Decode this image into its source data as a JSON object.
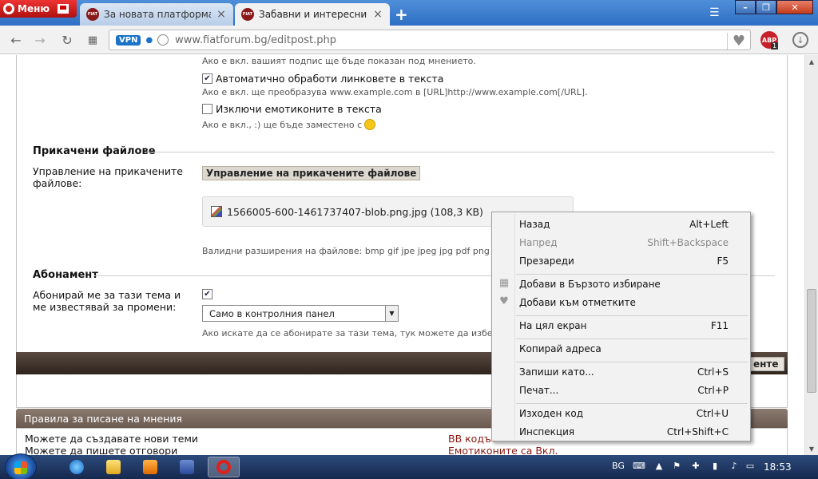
{
  "browser": {
    "menu_label": "Меню",
    "tabs": [
      {
        "title": "За новата платформа на",
        "active": false,
        "favicon": "FIAT"
      },
      {
        "title": "Забавни и интересни сни",
        "active": true,
        "favicon": "FIAT"
      }
    ],
    "address": {
      "vpn_label": "VPN",
      "url": "www.fiatforum.bg/editpost.php"
    },
    "abp_label": "ABP",
    "abp_count": "1"
  },
  "form": {
    "signature_hint": "Ако е вкл. вашият подпис ще бъде показан под мнението.",
    "auto_links_label": "Автоматично обработи линковете в текста",
    "auto_links_hint": "Ако е вкл. ще преобразува www.example.com в [URL]http://www.example.com[/URL].",
    "disable_smilies_label": "Изключи емотиконите в текста",
    "disable_smilies_hint": "Ако е вкл., :) ще бъде заместено с",
    "attachments_title": "Прикачени файлове",
    "manage_label": "Управление на прикачените файлове:",
    "manage_button": "Управление на прикачените файлове",
    "file_name": "1566005-600-1461737407-blob.png.jpg (108,3 KB)",
    "valid_ext": "Валидни разширения на файлове: bmp gif jpe jpeg jpg pdf png psd txt zip",
    "subscription_title": "Абонамент",
    "subscribe_label": "Абонирай ме за тази тема и ме известявай за промени:",
    "subscribe_select": "Само в контролния панел",
    "subscribe_hint": "Ако искате да се абонирате за тази тема, тук можете да изберете как да",
    "submit_label": "енте",
    "rules_title": "Правила за писане на мнения",
    "rules": [
      "Можете да създавате нови теми",
      "Можете да пишете отговори"
    ],
    "rules_right": [
      "BB кодът",
      "Емотиконите са Вкл."
    ]
  },
  "context_menu": {
    "groups": [
      [
        {
          "label": "Назад",
          "shortcut": "Alt+Left",
          "disabled": false
        },
        {
          "label": "Напред",
          "shortcut": "Shift+Backspace",
          "disabled": true
        },
        {
          "label": "Презареди",
          "shortcut": "F5",
          "disabled": false
        }
      ],
      [
        {
          "label": "Добави в Бързото избиране",
          "shortcut": "",
          "icon": "speed-dial-icon"
        },
        {
          "label": "Добави към отметките",
          "shortcut": "",
          "icon": "heart-icon"
        }
      ],
      [
        {
          "label": "На цял екран",
          "shortcut": "F11"
        }
      ],
      [
        {
          "label": "Копирай адреса",
          "shortcut": ""
        }
      ],
      [
        {
          "label": "Запиши като...",
          "shortcut": "Ctrl+S"
        },
        {
          "label": "Печат...",
          "shortcut": "Ctrl+P"
        }
      ],
      [
        {
          "label": "Изходен код",
          "shortcut": "Ctrl+U"
        },
        {
          "label": "Инспекция",
          "shortcut": "Ctrl+Shift+C"
        }
      ]
    ]
  },
  "taskbar": {
    "language": "BG",
    "clock": "18:53"
  }
}
